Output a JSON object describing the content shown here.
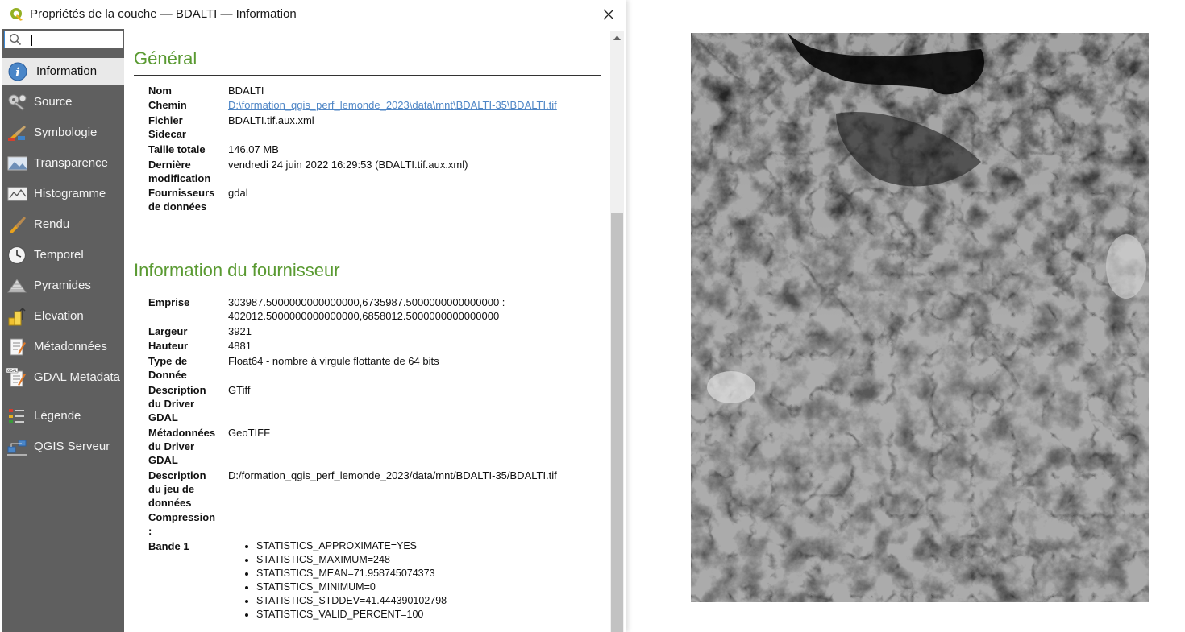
{
  "window": {
    "title": "Propriétés de la couche — BDALTI — Information"
  },
  "search": {
    "value": "",
    "placeholder": ""
  },
  "sidebar": {
    "items": [
      {
        "label": "Information",
        "icon": "info-icon"
      },
      {
        "label": "Source",
        "icon": "source-wrench-icon"
      },
      {
        "label": "Symbologie",
        "icon": "paintbrush-icon"
      },
      {
        "label": "Transparence",
        "icon": "transparency-icon"
      },
      {
        "label": "Histogramme",
        "icon": "histogram-icon"
      },
      {
        "label": "Rendu",
        "icon": "rendering-brush-icon"
      },
      {
        "label": "Temporel",
        "icon": "clock-icon"
      },
      {
        "label": "Pyramides",
        "icon": "pyramid-icon"
      },
      {
        "label": "Elevation",
        "icon": "elevation-icon"
      },
      {
        "label": "Métadonnées",
        "icon": "metadata-icon"
      },
      {
        "label": "GDAL Metadata",
        "icon": "gdal-metadata-icon"
      },
      {
        "label": "Légende",
        "icon": "legend-icon"
      },
      {
        "label": "QGIS Serveur",
        "icon": "qgis-server-icon"
      }
    ]
  },
  "general": {
    "title": "Général",
    "nom_key": "Nom",
    "nom_val": "BDALTI",
    "chemin_key": "Chemin",
    "chemin_val": "D:\\formation_qgis_perf_lemonde_2023\\data\\mnt\\BDALTI-35\\BDALTI.tif",
    "fichier_key_1": "Fichier",
    "fichier_key_2": "Sidecar",
    "fichier_val": "BDALTI.tif.aux.xml",
    "taille_key": "Taille totale",
    "taille_val": "146.07 MB",
    "modif_key_1": "Dernière",
    "modif_key_2": "modification",
    "modif_val": "vendredi 24 juin 2022 16:29:53 (BDALTI.tif.aux.xml)",
    "fourn_key_1": "Fournisseurs",
    "fourn_key_2": "de données",
    "fourn_val": "gdal"
  },
  "provider": {
    "title": "Information du fournisseur",
    "emprise_key": "Emprise",
    "emprise_val_1": "303987.5000000000000000,6735987.5000000000000000 :",
    "emprise_val_2": "402012.5000000000000000,6858012.5000000000000000",
    "largeur_key": "Largeur",
    "largeur_val": "3921",
    "hauteur_key": "Hauteur",
    "hauteur_val": "4881",
    "type_key_1": "Type de",
    "type_key_2": "Donnée",
    "type_val": "Float64 - nombre à virgule flottante de 64 bits",
    "driver_key_1": "Description",
    "driver_key_2": "du Driver",
    "driver_key_3": "GDAL",
    "driver_val": "GTiff",
    "meta_key_1": "Métadonnées",
    "meta_key_2": "du Driver",
    "meta_key_3": "GDAL",
    "meta_val": "GeoTIFF",
    "desc_key_1": "Description",
    "desc_key_2": "du jeu de",
    "desc_key_3": "données",
    "desc_val": "D:/formation_qgis_perf_lemonde_2023/data/mnt/BDALTI-35/BDALTI.tif",
    "compression_key_1": "Compression",
    "compression_key_2": ":",
    "bande_key": "Bande 1",
    "bande_stats": [
      "STATISTICS_APPROXIMATE=YES",
      "STATISTICS_MAXIMUM=248",
      "STATISTICS_MEAN=71.958745074373",
      "STATISTICS_MINIMUM=0",
      "STATISTICS_STDDEV=41.444390102798",
      "STATISTICS_VALID_PERCENT=100"
    ]
  },
  "colors": {
    "accent_green": "#5a9a32",
    "sidebar_bg": "#5f5f5f",
    "link_blue": "#4f86c6"
  }
}
